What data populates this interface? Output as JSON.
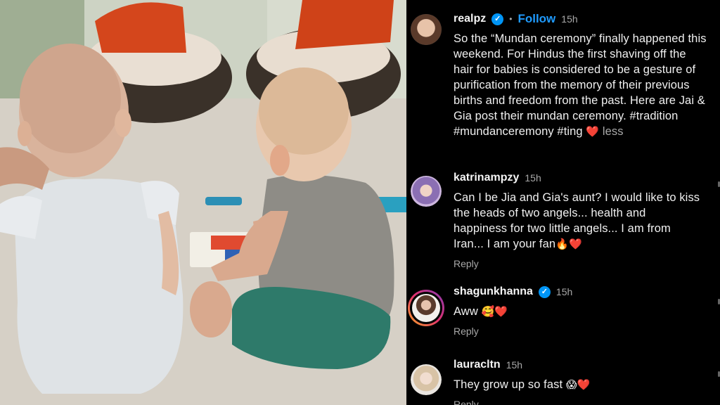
{
  "post": {
    "username": "realpz",
    "follow_label": "Follow",
    "dot": "•",
    "time": "15h",
    "caption": "So the “Mundan ceremony” finally happened this weekend.  For Hindus the first shaving off the hair for babies is considered to be a gesture of purification from the memory of their previous births and freedom from the past. Here are Jai & Gia post their mundan ceremony. #tradition #mundanceremony #ting",
    "caption_emoji": "❤️",
    "less_label": "less"
  },
  "comments": [
    {
      "username": "katrinampzy",
      "verified": false,
      "time": "15h",
      "text": "Can I be Jia and Gia's aunt? I would like to kiss the heads of two angels... health and happiness for two little angels... I am from Iran... I am your fan",
      "emoji": "🔥❤️",
      "reply_label": "Reply"
    },
    {
      "username": "shagunkhanna",
      "verified": true,
      "time": "15h",
      "text": "Aww",
      "emoji": "🥰❤️",
      "reply_label": "Reply"
    },
    {
      "username": "lauracltn",
      "verified": false,
      "time": "15h",
      "text": "They grow up so fast",
      "emoji": "😱❤️",
      "reply_label": "Reply"
    }
  ],
  "colors": {
    "background": "#000000",
    "follow": "#1f9bff",
    "verified": "#0095f6",
    "heart": "#e0245e",
    "muted": "#a8a8a8"
  },
  "icons": {
    "verified": "verified-badge-icon",
    "heart": "heart-icon"
  }
}
